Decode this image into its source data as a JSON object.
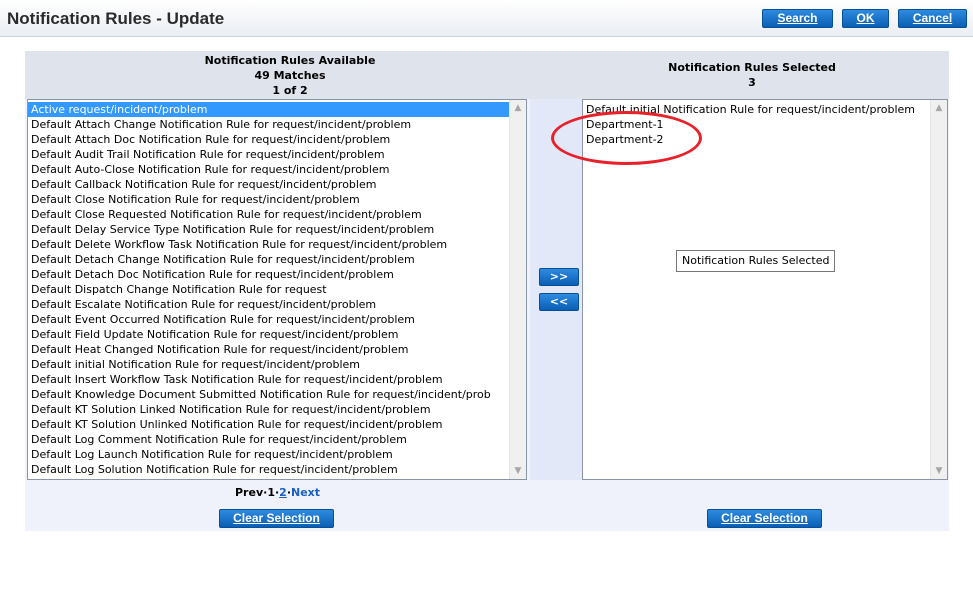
{
  "window": {
    "title": "Notification Rules - Update"
  },
  "toolbar": {
    "search_label": "Search",
    "ok_label": "OK",
    "cancel_label": "Cancel"
  },
  "available": {
    "header_title": "Notification Rules Available",
    "header_matches": "49 Matches",
    "header_page": "1 of 2",
    "items": [
      "Active request/incident/problem",
      "Default Attach Change Notification Rule for request/incident/problem",
      "Default Attach Doc Notification Rule for request/incident/problem",
      "Default Audit Trail Notification Rule for request/incident/problem",
      "Default Auto-Close Notification Rule for request/incident/problem",
      "Default Callback Notification Rule for request/incident/problem",
      "Default Close Notification Rule for request/incident/problem",
      "Default Close Requested Notification Rule for request/incident/problem",
      "Default Delay Service Type Notification Rule for request/incident/problem",
      "Default Delete Workflow Task Notification Rule for request/incident/problem",
      "Default Detach Change Notification Rule for request/incident/problem",
      "Default Detach Doc Notification Rule for request/incident/problem",
      "Default Dispatch Change Notification Rule for request",
      "Default Escalate Notification Rule for request/incident/problem",
      "Default Event Occurred Notification Rule for request/incident/problem",
      "Default Field Update Notification Rule for request/incident/problem",
      "Default Heat Changed Notification Rule for request/incident/problem",
      "Default initial Notification Rule for request/incident/problem",
      "Default Insert Workflow Task Notification Rule for request/incident/problem",
      "Default Knowledge Document Submitted Notification Rule for request/incident/prob",
      "Default KT Solution Linked Notification Rule for request/incident/problem",
      "Default KT Solution Unlinked Notification Rule for request/incident/problem",
      "Default Log Comment Notification Rule for request/incident/problem",
      "Default Log Launch Notification Rule for request/incident/problem",
      "Default Log Solution Notification Rule for request/incident/problem"
    ],
    "selected_index": 0,
    "pager": {
      "prev": "Prev",
      "sep": "·",
      "page1": "1",
      "page2": "2",
      "next": "Next"
    },
    "clear_label": "Clear Selection"
  },
  "transfer": {
    "add_label": ">>",
    "remove_label": "<<"
  },
  "selected": {
    "header_title": "Notification Rules Selected",
    "header_count": "3",
    "items": [
      "Default initial Notification Rule for request/incident/problem",
      "Department-1",
      "Department-2"
    ],
    "tooltip": "Notification Rules Selected",
    "clear_label": "Clear Selection"
  },
  "icons": {
    "scroll_up": "chevron-up-icon",
    "scroll_down": "chevron-down-icon"
  },
  "colors": {
    "button_blue": "#0a5fb4",
    "selection_blue": "#3399ff",
    "annotation_red": "#e8202a",
    "panel_bg": "#eff1fb"
  }
}
